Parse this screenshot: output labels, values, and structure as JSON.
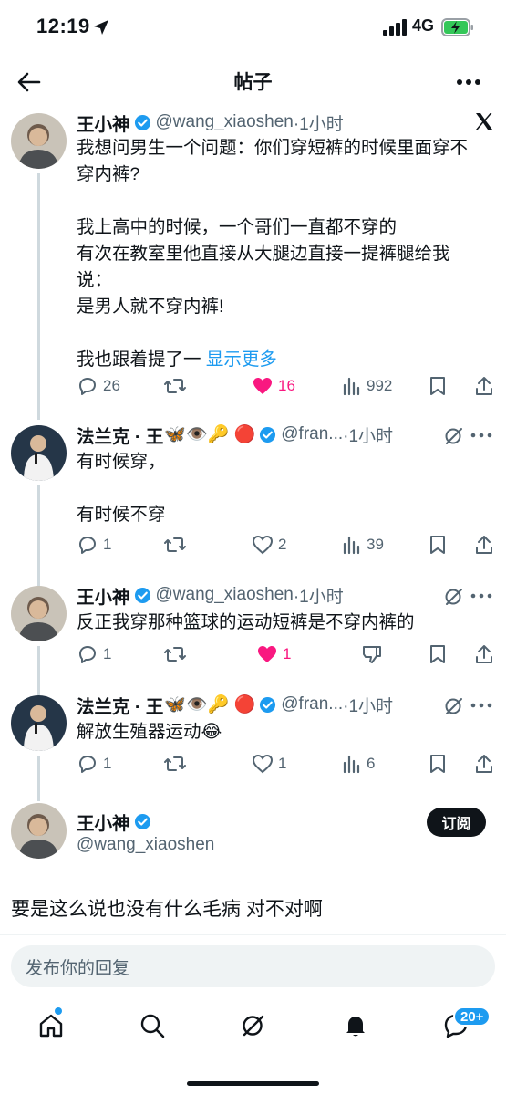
{
  "status_bar": {
    "time": "12:19",
    "network": "4G"
  },
  "nav": {
    "title": "帖子"
  },
  "posts": [
    {
      "name": "王小神",
      "handle": "@wang_xiaoshen",
      "time": "·1小时",
      "text": "我想问男生一个问题：你们穿短裤的时候里面穿不\n穿内裤?\n\n我上高中的时候，一个哥们一直都不穿的\n有次在教室里他直接从大腿边直接一提裤腿给我\n说：\n是男人就不穿内裤!\n\n我也跟着提了一 ",
      "more_label": "显示更多",
      "replies": "26",
      "retweets": "",
      "likes": "16",
      "views": "992"
    },
    {
      "name": "法兰克 · 王",
      "emojis": "🦋👁️🔑 🔴",
      "handle": "@fran...",
      "time": "·1小时",
      "text": "有时候穿，\n\n有时候不穿",
      "replies": "1",
      "likes": "2",
      "views": "39"
    },
    {
      "name": "王小神",
      "handle": "@wang_xiaoshen",
      "time": "·1小时",
      "text": "反正我穿那种篮球的运动短裤是不穿内裤的",
      "replies": "1",
      "likes": "1"
    },
    {
      "name": "法兰克 · 王",
      "emojis": "🦋👁️🔑 🔴",
      "handle": "@fran...",
      "time": "·1小时",
      "text": "解放生殖器运动😂",
      "replies": "1",
      "likes": "1",
      "views": "6"
    }
  ],
  "main_post": {
    "name": "王小神",
    "handle": "@wang_xiaoshen",
    "subscribe_label": "订阅",
    "text": "要是这么说也没有什么毛病 对不对啊"
  },
  "reply_box": {
    "placeholder": "发布你的回复"
  },
  "tabbar": {
    "messages_badge": "20+"
  },
  "colors": {
    "accent": "#1d9bf0",
    "like": "#f91880",
    "muted": "#536471",
    "text": "#0f1419"
  },
  "icons": [
    "back-arrow-icon",
    "more-icon",
    "x-logo-icon",
    "verified-icon",
    "reply-icon",
    "retweet-icon",
    "heart-icon",
    "views-icon",
    "bookmark-icon",
    "share-icon",
    "grok-icon",
    "dislike-icon",
    "home-icon",
    "search-icon",
    "bell-icon",
    "messages-icon"
  ]
}
